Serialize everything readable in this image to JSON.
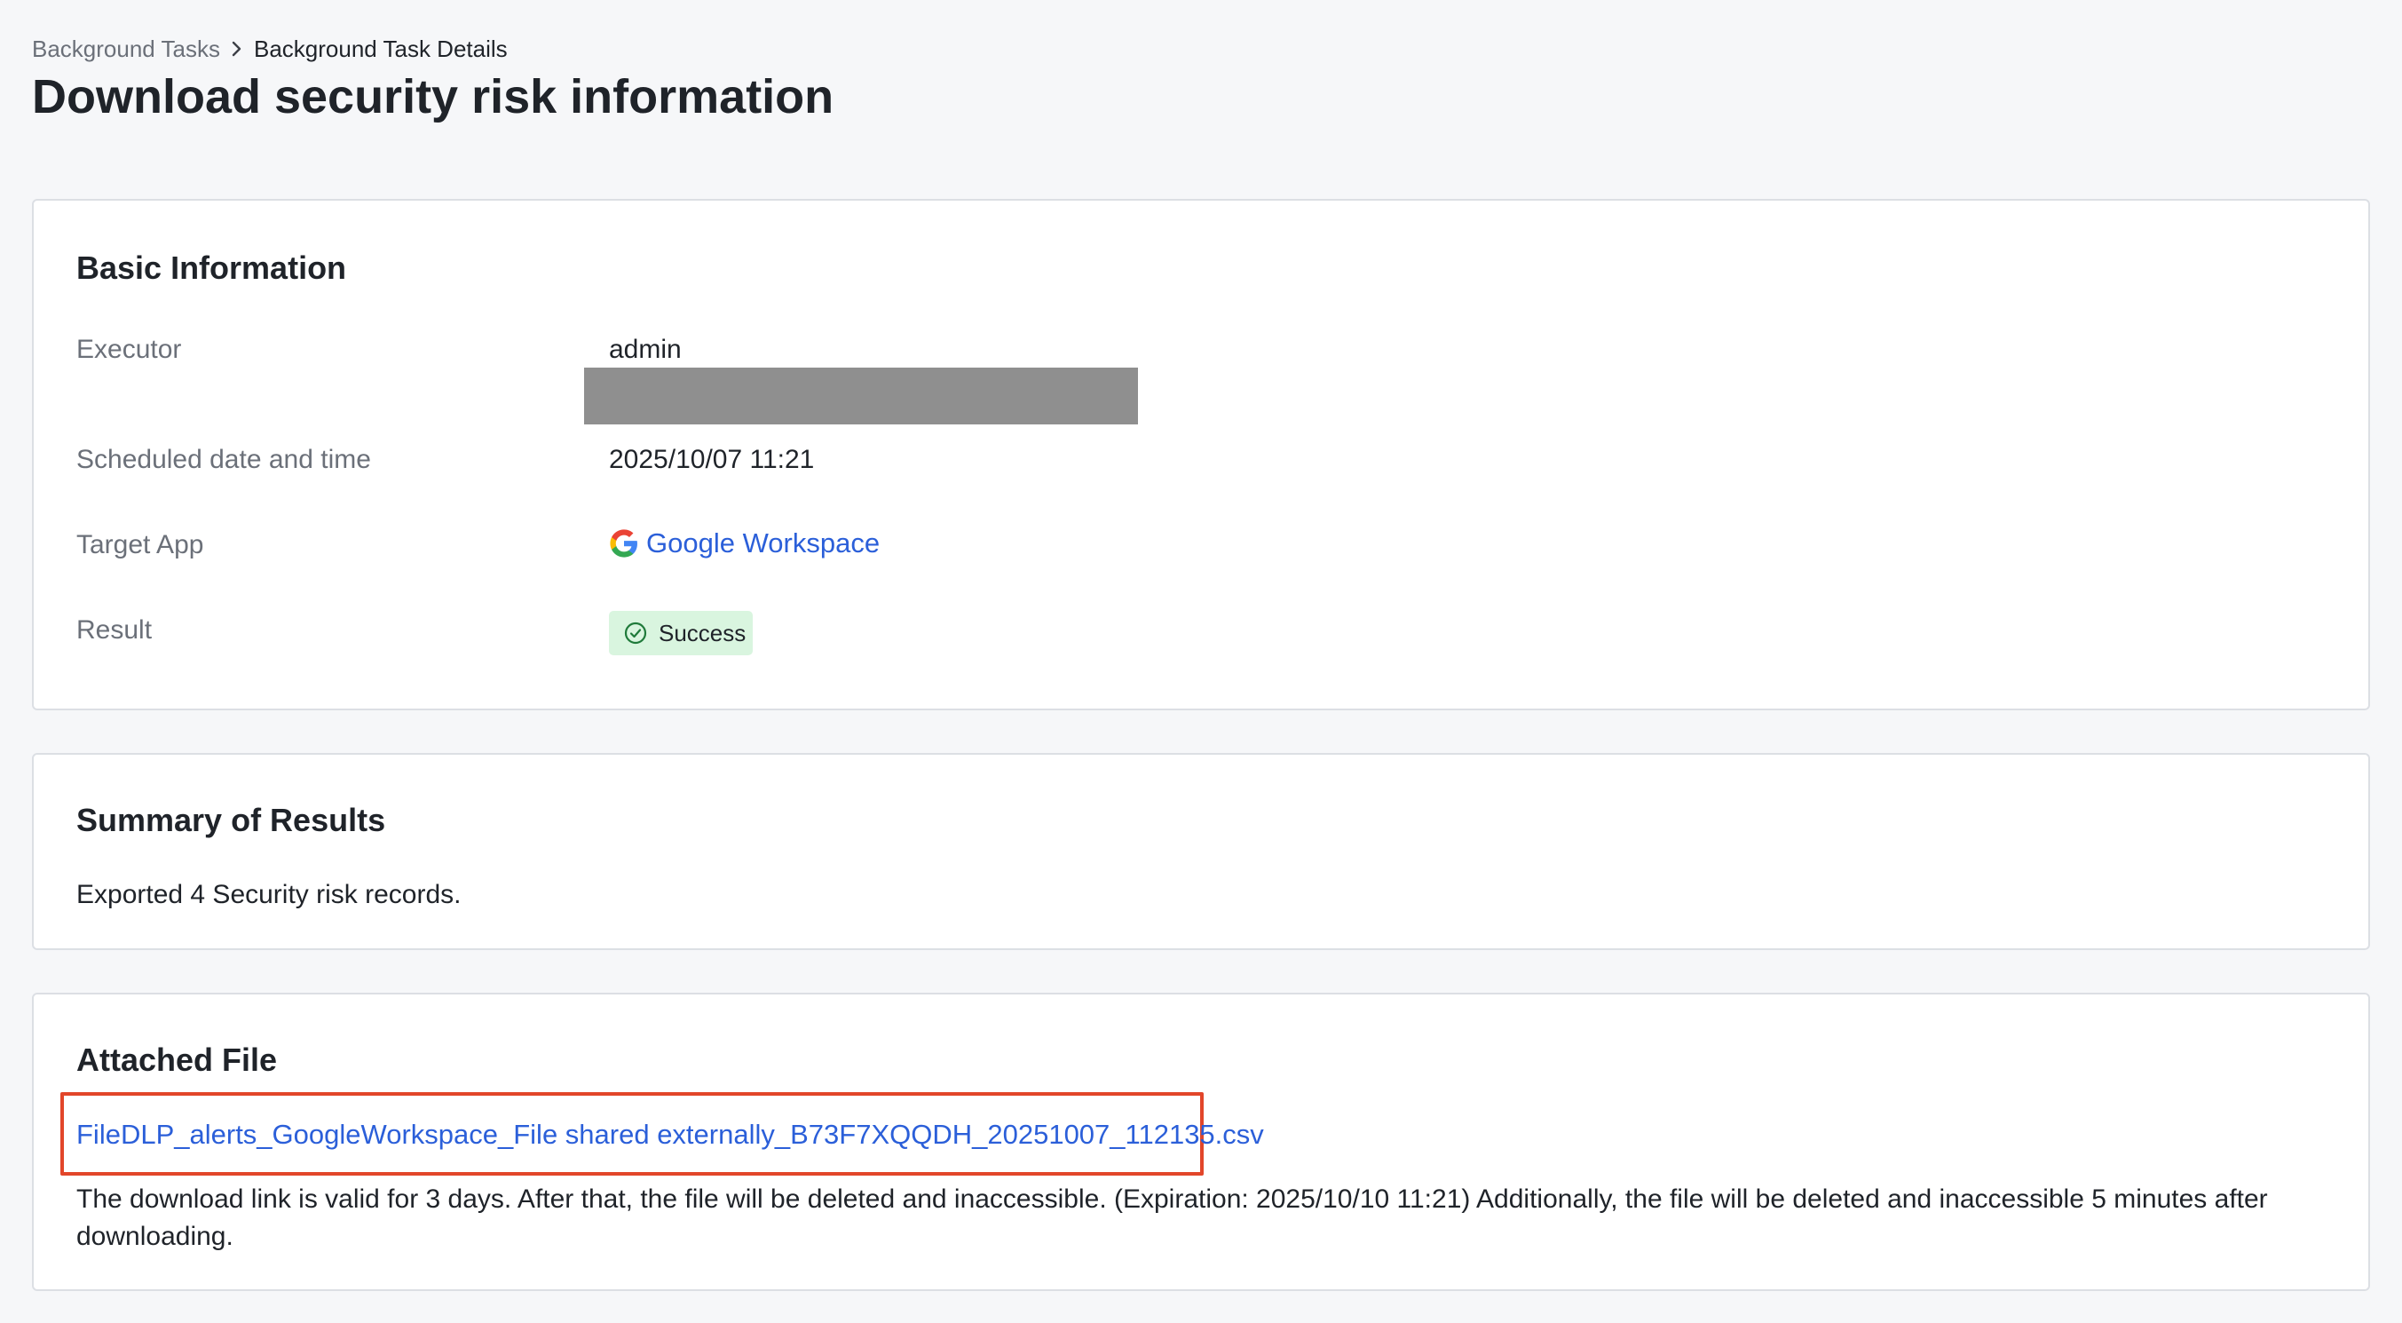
{
  "breadcrumb": {
    "parent": "Background Tasks",
    "current": "Background Task Details",
    "separator_icon": "chevron-right-icon"
  },
  "page": {
    "title": "Download security risk information"
  },
  "basic_info": {
    "title": "Basic Information",
    "executor_label": "Executor",
    "executor_value": "admin",
    "scheduled_label": "Scheduled date and time",
    "scheduled_value": "2025/10/07 11:21",
    "target_app_label": "Target App",
    "target_app_value": "Google Workspace",
    "target_app_icon": "google-logo-icon",
    "result_label": "Result",
    "result_value": "Success",
    "result_icon": "check-circle-icon"
  },
  "summary": {
    "title": "Summary of Results",
    "text": "Exported 4 Security risk records."
  },
  "attached": {
    "title": "Attached File",
    "file_name": "FileDLP_alerts_GoogleWorkspace_File shared externally_B73F7XQQDH_20251007_112135.csv",
    "note": "The download link is valid for 3 days. After that, the file will be deleted and inaccessible. (Expiration: 2025/10/10 11:21) Additionally, the file will be deleted and inaccessible 5 minutes after downloading."
  },
  "colors": {
    "link": "#2b5fd9",
    "success_bg": "#d9f5df",
    "highlight_border": "#e2462a",
    "redaction": "#8f8f8f"
  }
}
